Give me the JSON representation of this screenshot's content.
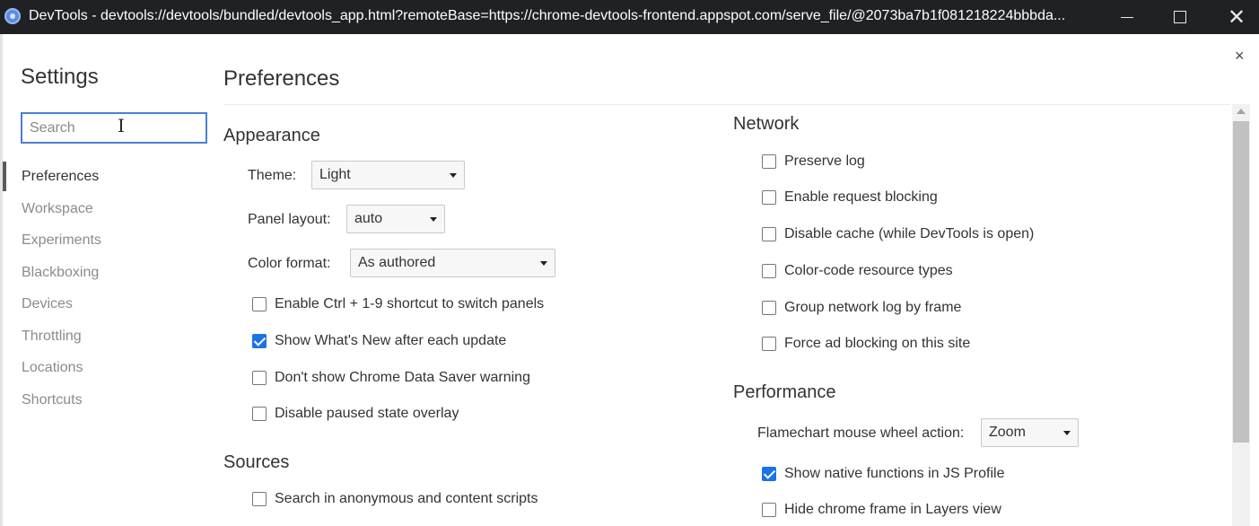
{
  "window": {
    "title": "DevTools - devtools://devtools/bundled/devtools_app.html?remoteBase=https://chrome-devtools-frontend.appspot.com/serve_file/@2073ba7b1f081218224bbbda..."
  },
  "dialog": {
    "close_glyph": "×"
  },
  "sidebar": {
    "title": "Settings",
    "search_placeholder": "Search",
    "items": [
      {
        "label": "Preferences"
      },
      {
        "label": "Workspace"
      },
      {
        "label": "Experiments"
      },
      {
        "label": "Blackboxing"
      },
      {
        "label": "Devices"
      },
      {
        "label": "Throttling"
      },
      {
        "label": "Locations"
      },
      {
        "label": "Shortcuts"
      }
    ],
    "active_item": "Preferences"
  },
  "main": {
    "title": "Preferences",
    "appearance": {
      "heading": "Appearance",
      "theme_label": "Theme:",
      "theme_value": "Light",
      "panel_layout_label": "Panel layout:",
      "panel_layout_value": "auto",
      "color_format_label": "Color format:",
      "color_format_value": "As authored",
      "checkboxes": [
        {
          "label": "Enable Ctrl + 1-9 shortcut to switch panels",
          "checked": false
        },
        {
          "label": "Show What's New after each update",
          "checked": true
        },
        {
          "label": "Don't show Chrome Data Saver warning",
          "checked": false
        },
        {
          "label": "Disable paused state overlay",
          "checked": false
        }
      ]
    },
    "sources": {
      "heading": "Sources",
      "checkboxes": [
        {
          "label": "Search in anonymous and content scripts",
          "checked": false
        }
      ]
    },
    "network": {
      "heading": "Network",
      "checkboxes": [
        {
          "label": "Preserve log",
          "checked": false
        },
        {
          "label": "Enable request blocking",
          "checked": false
        },
        {
          "label": "Disable cache (while DevTools is open)",
          "checked": false
        },
        {
          "label": "Color-code resource types",
          "checked": false
        },
        {
          "label": "Group network log by frame",
          "checked": false
        },
        {
          "label": "Force ad blocking on this site",
          "checked": false
        }
      ]
    },
    "performance": {
      "heading": "Performance",
      "flamechart_label": "Flamechart mouse wheel action:",
      "flamechart_value": "Zoom",
      "checkboxes": [
        {
          "label": "Show native functions in JS Profile",
          "checked": true
        },
        {
          "label": "Hide chrome frame in Layers view",
          "checked": false
        }
      ]
    }
  },
  "colors": {
    "titlebar_bg": "#202124",
    "focus_blue": "#4c7fd6",
    "checkbox_checked": "#1a73e8"
  }
}
